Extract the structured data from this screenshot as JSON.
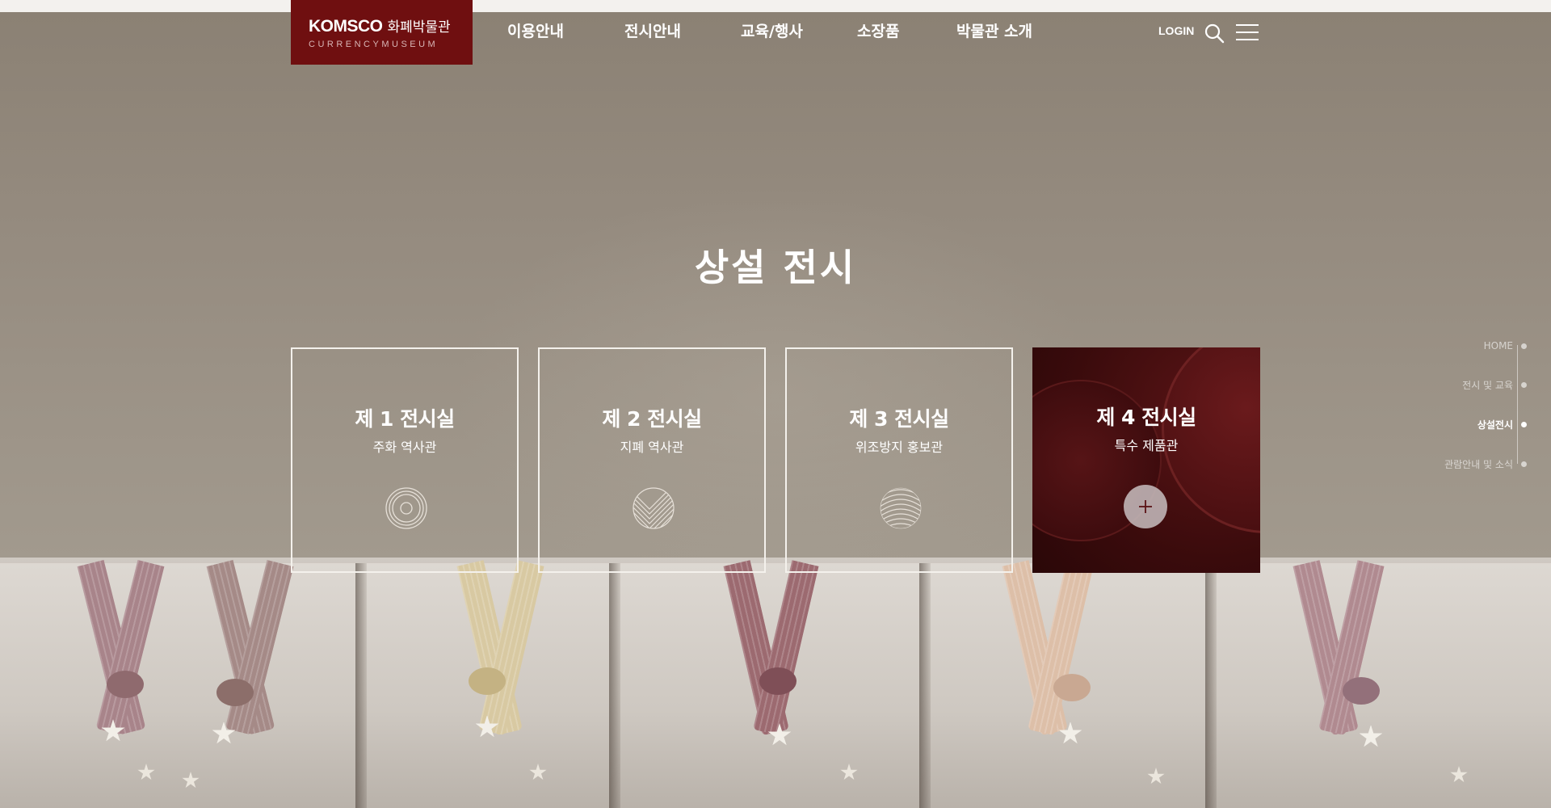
{
  "header": {
    "logo_brand": "KOMSCO",
    "logo_korean": "화폐박물관",
    "logo_sub": "CURRENCYMUSEUM",
    "nav": [
      {
        "label": "이용안내"
      },
      {
        "label": "전시안내"
      },
      {
        "label": "교육/행사"
      },
      {
        "label": "소장품"
      },
      {
        "label": "박물관 소개"
      }
    ],
    "login_label": "LOGIN",
    "search_icon": "search-icon",
    "menu_icon": "hamburger-menu-icon"
  },
  "main": {
    "title": "상설 전시",
    "cards": [
      {
        "title": "제 1 전시실",
        "subtitle": "주화 역사관",
        "icon": "coin-rings-icon"
      },
      {
        "title": "제 2 전시실",
        "subtitle": "지폐 역사관",
        "icon": "banknote-lines-icon"
      },
      {
        "title": "제 3 전시실",
        "subtitle": "위조방지 홍보관",
        "icon": "fingerprint-icon"
      },
      {
        "title": "제 4 전시실",
        "subtitle": "특수 제품관",
        "icon": "plus-icon"
      }
    ]
  },
  "side_nav": {
    "items": [
      {
        "label": "HOME"
      },
      {
        "label": "전시 및 교육"
      },
      {
        "label": "상설전시"
      },
      {
        "label": "관람안내 및 소식"
      }
    ],
    "current_index": 2
  },
  "colors": {
    "logo_bg": "#6f0f10",
    "active_card_bg": "#3a0b0c",
    "text": "#ffffff"
  }
}
